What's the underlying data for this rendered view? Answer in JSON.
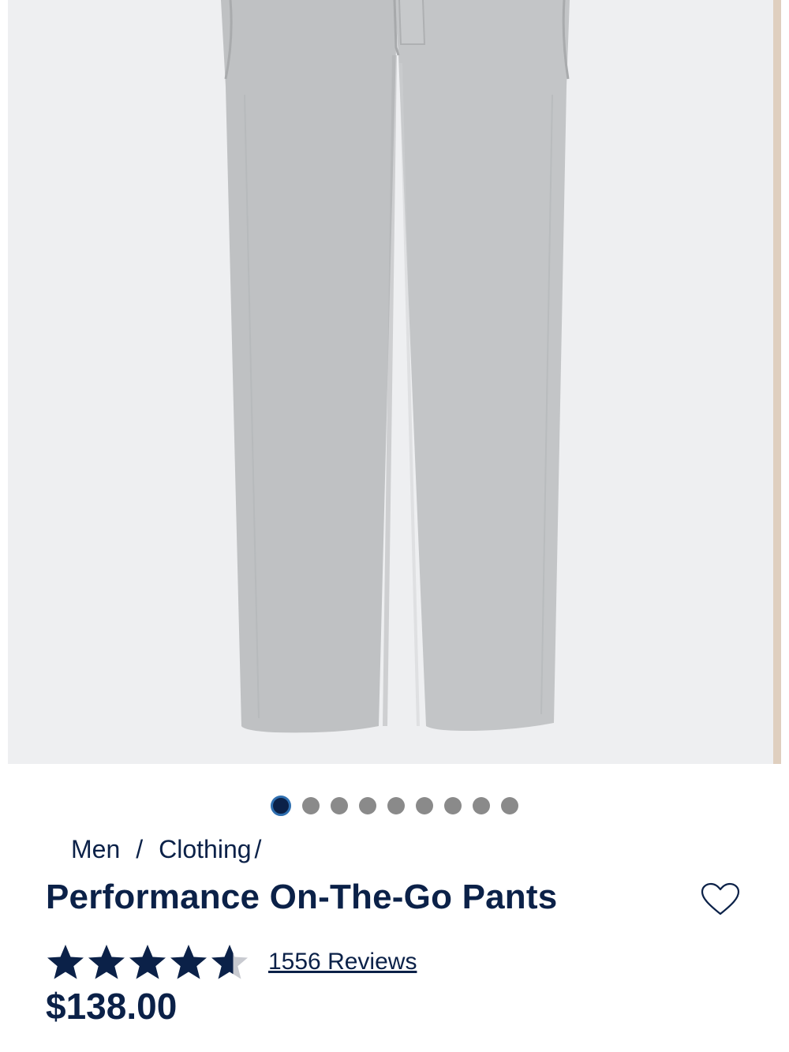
{
  "product_image": {
    "alt_icon": "pants-image",
    "background": "#eeeff1",
    "pants_color": "#bfc1c3"
  },
  "carousel": {
    "dot_count": 9,
    "active_index": 0
  },
  "breadcrumb": {
    "men": "Men",
    "sep1": "/",
    "clothing": "Clothing",
    "sep2": "/"
  },
  "product": {
    "title": "Performance On-The-Go Pants",
    "price": "$138.00",
    "rating": 4.6,
    "reviews_label": "1556 Reviews"
  },
  "colors": {
    "brand_navy": "#0b2148",
    "star_empty": "#c8cad0"
  }
}
